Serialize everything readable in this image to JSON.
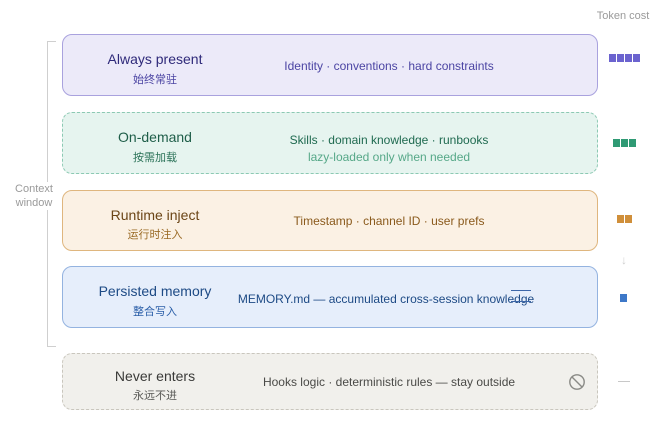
{
  "header": {
    "token_cost_label": "Token cost"
  },
  "context_window": {
    "label_line1": "Context",
    "label_line2": "window"
  },
  "layers": [
    {
      "name": "Always present",
      "subtitle": "始终常驻",
      "description": "Identity · conventions · hard constraints",
      "border_style": "solid",
      "color": "#6b63cf",
      "token_cost_blocks": 4
    },
    {
      "name": "On-demand",
      "subtitle": "按需加载",
      "description": "Skills · domain knowledge · runbooks",
      "note": "lazy-loaded only when needed",
      "border_style": "dashed",
      "color": "#2f9a74",
      "token_cost_blocks": 3
    },
    {
      "name": "Runtime inject",
      "subtitle": "运行时注入",
      "description": "Timestamp · channel ID · user prefs",
      "border_style": "solid",
      "color": "#d08f3a",
      "token_cost_blocks": 2
    },
    {
      "name": "Persisted memory",
      "subtitle": "整合写入",
      "description": "MEMORY.md — accumulated cross-session knowledge",
      "border_style": "solid",
      "color": "#3d78c8",
      "icon": "document-lines-icon",
      "token_cost_blocks": 1
    },
    {
      "name": "Never enters",
      "subtitle": "永远不进",
      "description": "Hooks logic · deterministic rules — stay outside",
      "border_style": "dashed",
      "color": "#8a8a86",
      "icon": "no-entry-icon",
      "token_cost_blocks": 0
    }
  ],
  "indicators": {
    "down_arrow_icon": "↓",
    "none_mark_icon": "dash-icon"
  }
}
